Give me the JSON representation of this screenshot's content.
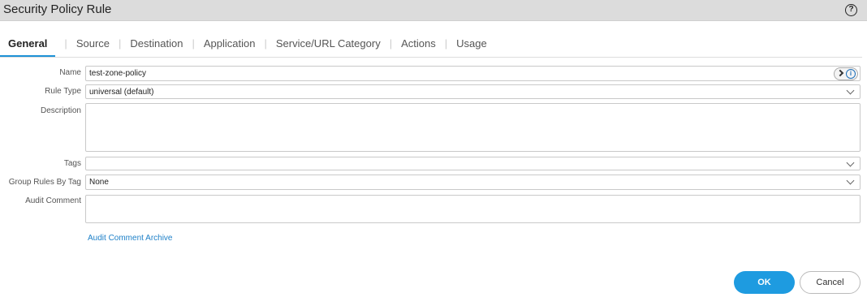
{
  "dialog": {
    "title": "Security Policy Rule",
    "help_icon": "help-icon"
  },
  "tabs": [
    {
      "label": "General",
      "active": true
    },
    {
      "label": "Source"
    },
    {
      "label": "Destination"
    },
    {
      "label": "Application"
    },
    {
      "label": "Service/URL Category"
    },
    {
      "label": "Actions"
    },
    {
      "label": "Usage"
    }
  ],
  "tab_separator": "|",
  "form": {
    "name": {
      "label": "Name",
      "value": "test-zone-policy"
    },
    "rule_type": {
      "label": "Rule Type",
      "value": "universal (default)"
    },
    "description": {
      "label": "Description",
      "value": ""
    },
    "tags": {
      "label": "Tags",
      "value": ""
    },
    "group_rules_by_tag": {
      "label": "Group Rules By Tag",
      "value": "None"
    },
    "audit_comment": {
      "label": "Audit Comment",
      "value": ""
    },
    "audit_comment_archive_link": "Audit Comment Archive"
  },
  "buttons": {
    "ok": "OK",
    "cancel": "Cancel"
  },
  "colors": {
    "accent": "#1e9be0",
    "tab_underline": "#1e92d6",
    "link": "#1e80c8",
    "titlebar": "#dcdcdc"
  }
}
